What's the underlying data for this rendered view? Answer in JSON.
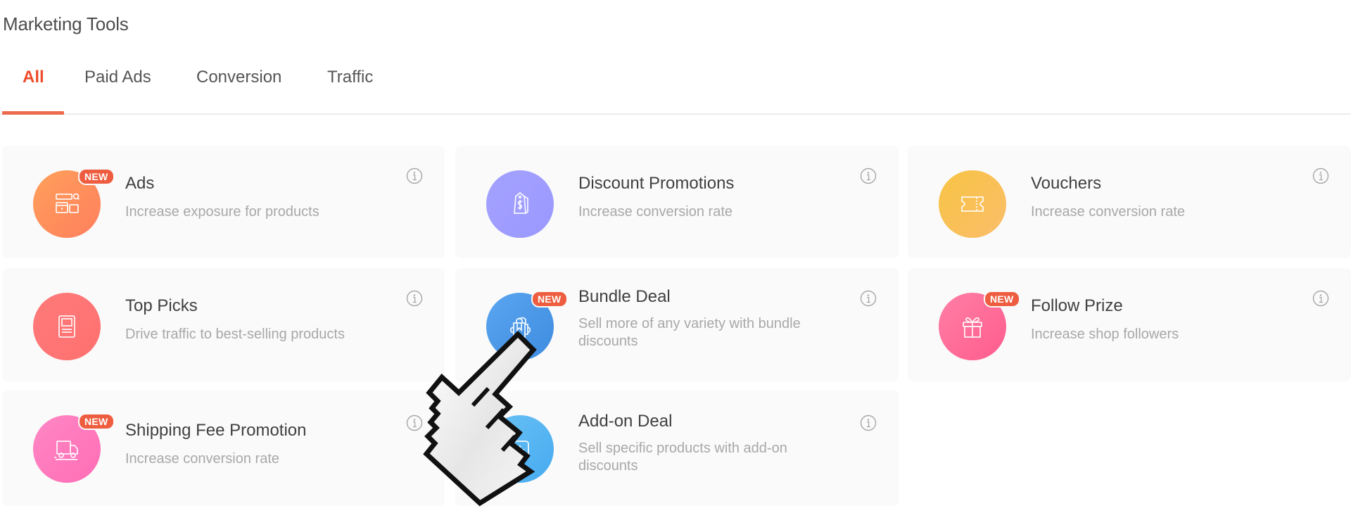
{
  "page": {
    "title": "Marketing Tools"
  },
  "tabs": [
    {
      "label": "All",
      "active": true
    },
    {
      "label": "Paid Ads",
      "active": false
    },
    {
      "label": "Conversion",
      "active": false
    },
    {
      "label": "Traffic",
      "active": false
    }
  ],
  "colors": {
    "accent": "#ee4d2d",
    "badge": "#ee5d3f",
    "card_bg": "#fafafa"
  },
  "tools": [
    {
      "title": "Ads",
      "description": "Increase exposure for products",
      "icon": "ads-icon",
      "badge": "NEW",
      "color_from": "#ffa05a",
      "color_to": "#ff7f5e"
    },
    {
      "title": "Discount Promotions",
      "description": "Increase conversion rate",
      "icon": "price-tag-icon",
      "badge": null,
      "color_from": "#a4a2ff",
      "color_to": "#9b98ff"
    },
    {
      "title": "Vouchers",
      "description": "Increase conversion rate",
      "icon": "voucher-ticket-icon",
      "badge": null,
      "color_from": "#f7c444",
      "color_to": "#fbbd6a"
    },
    {
      "title": "Top Picks",
      "description": "Drive traffic to best-selling products",
      "icon": "top-picks-icon",
      "badge": null,
      "color_from": "#ff7a7a",
      "color_to": "#ff7070"
    },
    {
      "title": "Bundle Deal",
      "description": "Sell more of any variety with bundle discounts",
      "icon": "shopping-bags-icon",
      "badge": "NEW",
      "color_from": "#5aa6f0",
      "color_to": "#3f8be0"
    },
    {
      "title": "Follow Prize",
      "description": "Increase shop followers",
      "icon": "gift-icon",
      "badge": "NEW",
      "color_from": "#ff7fa6",
      "color_to": "#ff5c8d"
    },
    {
      "title": "Shipping Fee Promotion",
      "description": "Increase conversion rate",
      "icon": "delivery-truck-icon",
      "badge": "NEW",
      "color_from": "#ff87c4",
      "color_to": "#ff6db6"
    },
    {
      "title": "Add-on Deal",
      "description": "Sell specific products with add-on discounts",
      "icon": "add-on-icon",
      "badge": null,
      "color_from": "#6ac2f5",
      "color_to": "#46aaf0"
    }
  ],
  "cursor": {
    "type": "hand-pointer"
  }
}
